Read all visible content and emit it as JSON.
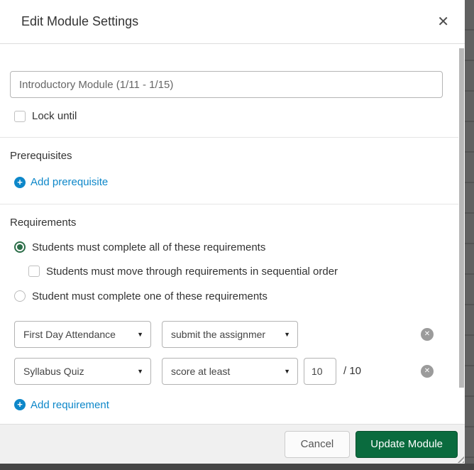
{
  "dialog": {
    "title": "Edit Module Settings",
    "close_icon": "✕"
  },
  "icons": {
    "plus": "+",
    "delete_x": "✕",
    "caret_down": "▼"
  },
  "form": {
    "module_name": {
      "value": "Introductory Module (1/11 - 1/15)"
    },
    "lock_until_label": "Lock until",
    "prerequisites": {
      "heading": "Prerequisites",
      "add_link_label": "Add prerequisite"
    },
    "requirements": {
      "heading": "Requirements",
      "radio_all_label": "Students must complete all of these requirements",
      "checkbox_sequential_label": "Students must move through requirements in sequential order",
      "radio_one_label": "Student must complete one of these requirements",
      "rows": [
        {
          "item": "First Day Attendance",
          "condition": "submit the assignmer"
        },
        {
          "item": "Syllabus Quiz",
          "condition": "score at least",
          "score": "10",
          "total": "/ 10"
        }
      ],
      "add_link_label": "Add requirement"
    }
  },
  "footer": {
    "cancel_label": "Cancel",
    "submit_label": "Update Module"
  },
  "colors": {
    "link_blue": "#0d87c9",
    "radio_green": "#2c6e49",
    "button_green": "#0a6b3e",
    "backdrop_gray": "#616161",
    "footer_gray": "#f0f0f0"
  }
}
